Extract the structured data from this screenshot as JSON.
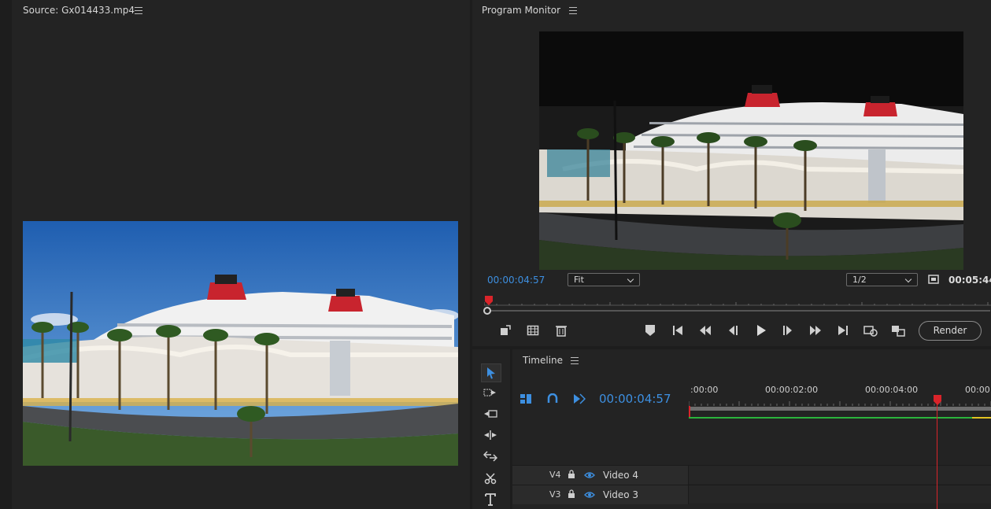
{
  "source": {
    "title": "Source: Gx014433.mp4"
  },
  "program": {
    "title": "Program Monitor",
    "timecode": "00:00:04:57",
    "fit_value": "Fit",
    "resolution_value": "1/2",
    "duration": "00:05:44",
    "render_label": "Render"
  },
  "timeline": {
    "title": "Timeline",
    "timecode": "00:00:04:57",
    "ruler_labels": [
      ":00:00",
      "00:00:02:00",
      "00:00:04:00",
      "00:00"
    ],
    "tracks": [
      {
        "id": "V4",
        "name": "Video 4"
      },
      {
        "id": "V3",
        "name": "Video 3"
      }
    ]
  },
  "colors": {
    "accent_blue": "#3d8fe0",
    "playhead_red": "#d9242a",
    "panel_bg": "#232323"
  }
}
